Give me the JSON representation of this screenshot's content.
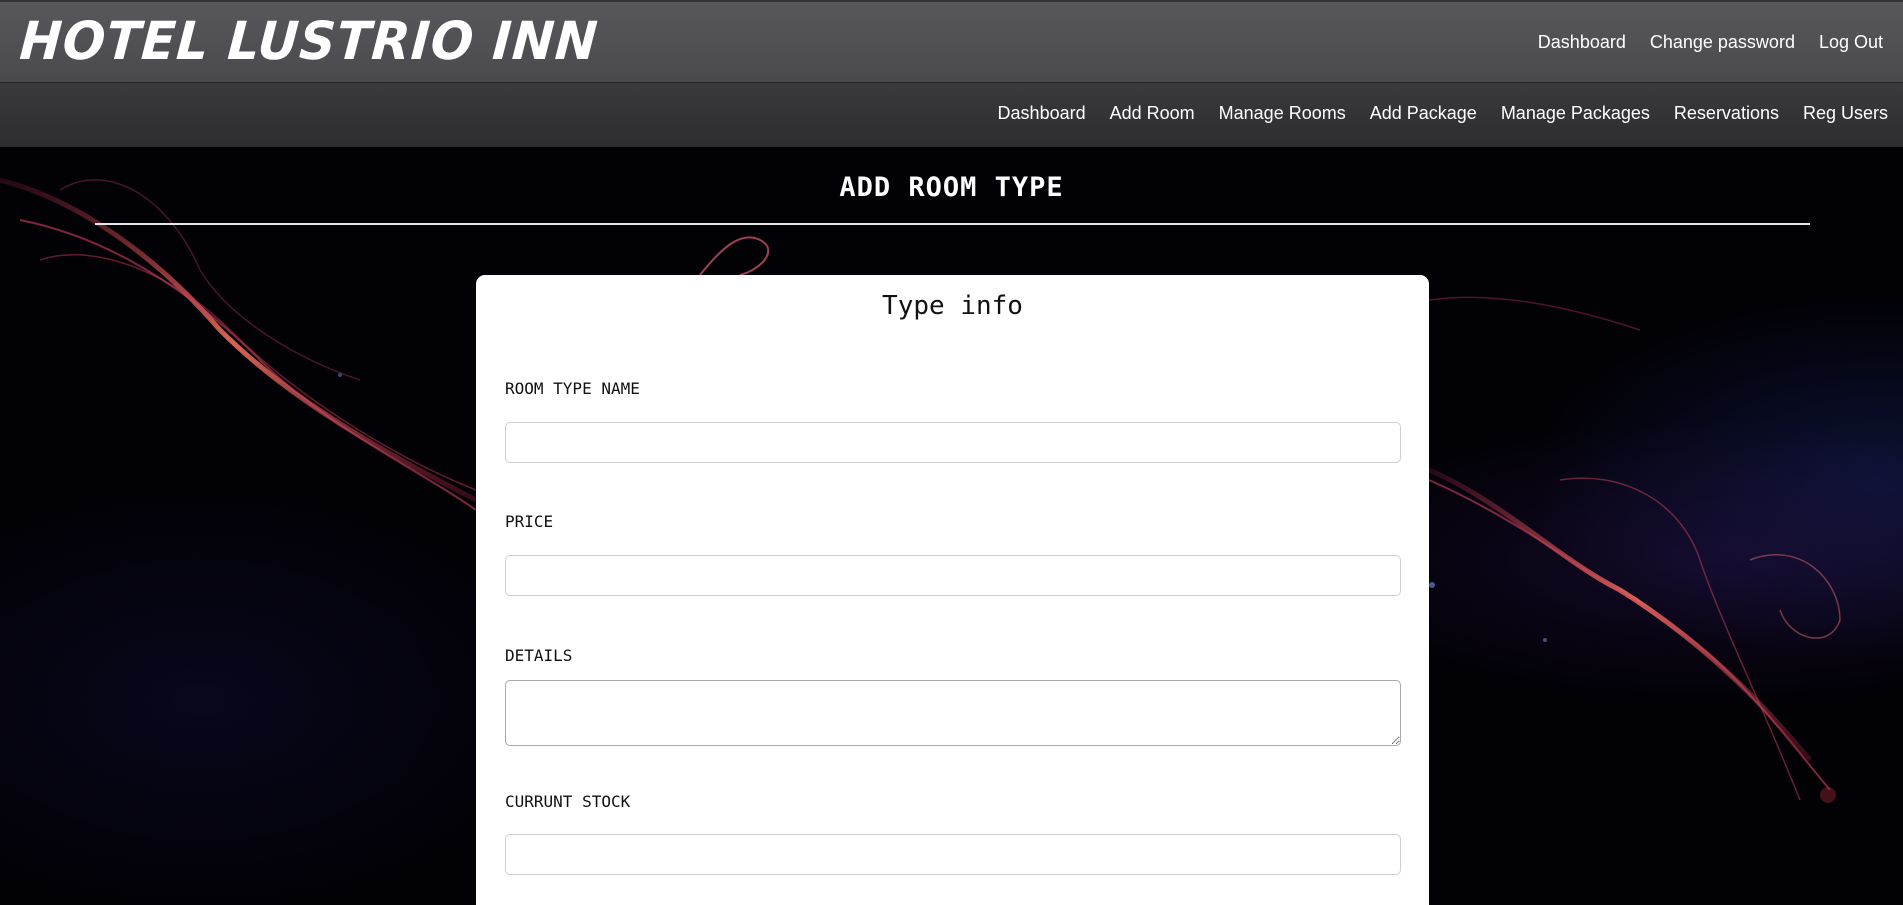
{
  "header": {
    "brand": "HOTEL LUSTRIO INN",
    "top_nav": [
      {
        "label": "Dashboard"
      },
      {
        "label": "Change password"
      },
      {
        "label": "Log Out"
      }
    ]
  },
  "sub_nav": [
    {
      "label": "Dashboard"
    },
    {
      "label": "Add Room"
    },
    {
      "label": "Manage Rooms"
    },
    {
      "label": "Add Package"
    },
    {
      "label": "Manage Packages"
    },
    {
      "label": "Reservations"
    },
    {
      "label": "Reg Users"
    }
  ],
  "page": {
    "title": "ADD ROOM TYPE"
  },
  "form": {
    "card_title": "Type info",
    "fields": {
      "room_type_name": {
        "label": "ROOM TYPE NAME",
        "value": ""
      },
      "price": {
        "label": "PRICE",
        "value": ""
      },
      "details": {
        "label": "DETAILS",
        "value": ""
      },
      "current_stock": {
        "label": "CURRUNT STOCK",
        "value": ""
      }
    }
  },
  "colors": {
    "header_bg": "#525256",
    "subnav_bg": "#343438",
    "page_bg": "#020106",
    "accent_streak": "#e0485a",
    "card_bg": "#ffffff"
  }
}
